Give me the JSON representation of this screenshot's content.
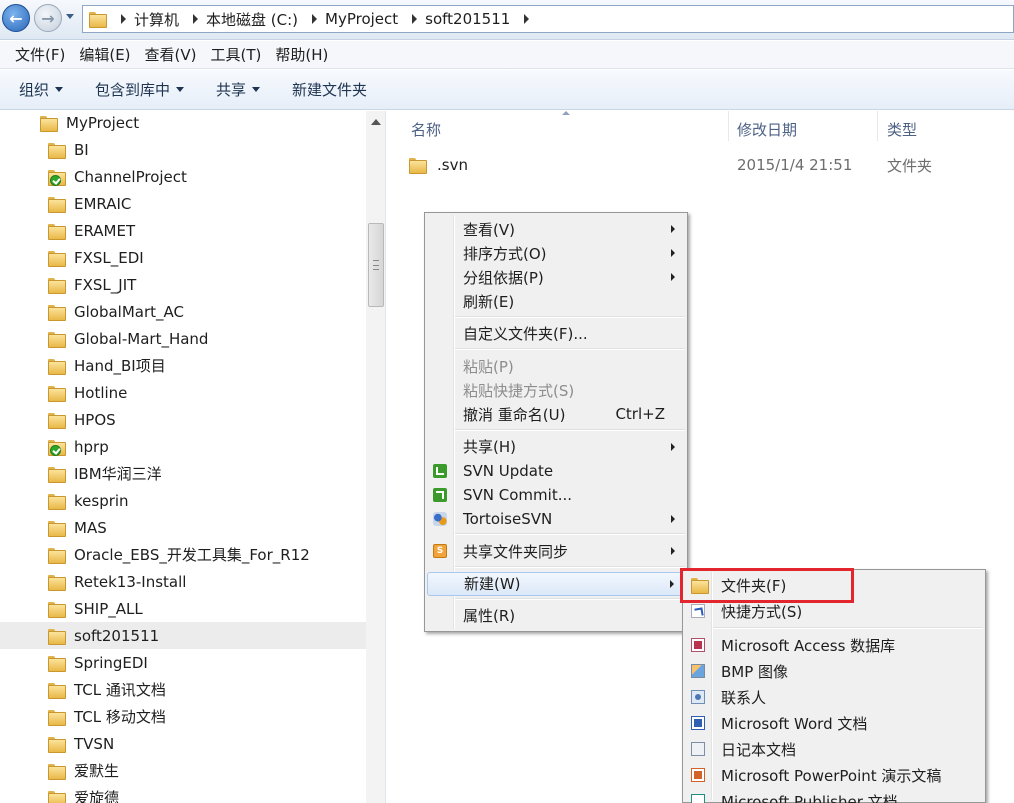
{
  "address": {
    "crumbs": [
      "计算机",
      "本地磁盘 (C:)",
      "MyProject",
      "soft201511"
    ]
  },
  "menubar": [
    "文件(F)",
    "编辑(E)",
    "查看(V)",
    "工具(T)",
    "帮助(H)"
  ],
  "commands": [
    {
      "label": "组织",
      "dropdown": true
    },
    {
      "label": "包含到库中",
      "dropdown": true
    },
    {
      "label": "共享",
      "dropdown": true
    },
    {
      "label": "新建文件夹",
      "dropdown": false
    }
  ],
  "tree": {
    "root": "MyProject",
    "items": [
      {
        "label": "BI",
        "svn": false
      },
      {
        "label": "ChannelProject",
        "svn": true
      },
      {
        "label": "EMRAIC",
        "svn": false
      },
      {
        "label": "ERAMET",
        "svn": false
      },
      {
        "label": "FXSL_EDI",
        "svn": false
      },
      {
        "label": "FXSL_JIT",
        "svn": false
      },
      {
        "label": "GlobalMart_AC",
        "svn": false
      },
      {
        "label": "Global-Mart_Hand",
        "svn": false
      },
      {
        "label": "Hand_BI项目",
        "svn": false
      },
      {
        "label": "Hotline",
        "svn": false
      },
      {
        "label": "HPOS",
        "svn": false
      },
      {
        "label": "hprp",
        "svn": true
      },
      {
        "label": "IBM华润三洋",
        "svn": false
      },
      {
        "label": "kesprin",
        "svn": false
      },
      {
        "label": "MAS",
        "svn": false
      },
      {
        "label": "Oracle_EBS_开发工具集_For_R12",
        "svn": false
      },
      {
        "label": "Retek13-Install",
        "svn": false
      },
      {
        "label": "SHIP_ALL",
        "svn": false
      },
      {
        "label": "soft201511",
        "svn": false,
        "selected": true
      },
      {
        "label": "SpringEDI",
        "svn": false
      },
      {
        "label": "TCL 通讯文档",
        "svn": false
      },
      {
        "label": "TCL 移动文档",
        "svn": false
      },
      {
        "label": "TVSN",
        "svn": false
      },
      {
        "label": "爱默生",
        "svn": false
      },
      {
        "label": "爱旋德",
        "svn": false
      }
    ]
  },
  "filelist": {
    "columns": {
      "name": "名称",
      "modified": "修改日期",
      "type": "类型"
    },
    "rows": [
      {
        "name": ".svn",
        "modified": "2015/1/4 21:51",
        "type": "文件夹"
      }
    ]
  },
  "context_menu": {
    "items": [
      {
        "kind": "item",
        "label": "查看(V)",
        "submenu": true
      },
      {
        "kind": "item",
        "label": "排序方式(O)",
        "submenu": true
      },
      {
        "kind": "item",
        "label": "分组依据(P)",
        "submenu": true
      },
      {
        "kind": "item",
        "label": "刷新(E)"
      },
      {
        "kind": "sep"
      },
      {
        "kind": "item",
        "label": "自定义文件夹(F)..."
      },
      {
        "kind": "sep"
      },
      {
        "kind": "item",
        "label": "粘贴(P)",
        "disabled": true
      },
      {
        "kind": "item",
        "label": "粘贴快捷方式(S)",
        "disabled": true
      },
      {
        "kind": "item",
        "label": "撤消 重命名(U)",
        "shortcut": "Ctrl+Z"
      },
      {
        "kind": "sep"
      },
      {
        "kind": "item",
        "label": "共享(H)",
        "submenu": true
      },
      {
        "kind": "item",
        "label": "SVN Update",
        "icon": "svn-update-icon"
      },
      {
        "kind": "item",
        "label": "SVN Commit...",
        "icon": "svn-commit-icon"
      },
      {
        "kind": "item",
        "label": "TortoiseSVN",
        "icon": "tortoisesvn-icon",
        "submenu": true
      },
      {
        "kind": "sep"
      },
      {
        "kind": "item",
        "label": "共享文件夹同步",
        "icon": "sync-icon",
        "submenu": true
      },
      {
        "kind": "sep"
      },
      {
        "kind": "item",
        "label": "新建(W)",
        "submenu": true,
        "highlighted": true
      },
      {
        "kind": "sep"
      },
      {
        "kind": "item",
        "label": "属性(R)"
      }
    ]
  },
  "new_submenu": {
    "items": [
      {
        "kind": "item",
        "label": "文件夹(F)",
        "icon": "folder-icon"
      },
      {
        "kind": "item",
        "label": "快捷方式(S)",
        "icon": "shortcut-icon"
      },
      {
        "kind": "sep"
      },
      {
        "kind": "item",
        "label": "Microsoft Access 数据库",
        "icon": "access-icon"
      },
      {
        "kind": "item",
        "label": "BMP 图像",
        "icon": "bmp-icon"
      },
      {
        "kind": "item",
        "label": "联系人",
        "icon": "contact-icon"
      },
      {
        "kind": "item",
        "label": "Microsoft Word 文档",
        "icon": "word-icon"
      },
      {
        "kind": "item",
        "label": "日记本文档",
        "icon": "journal-icon"
      },
      {
        "kind": "item",
        "label": "Microsoft PowerPoint 演示文稿",
        "icon": "powerpoint-icon"
      },
      {
        "kind": "item",
        "label": "Microsoft Publisher 文档",
        "icon": "publisher-icon"
      }
    ]
  },
  "colors": {
    "highlight_box": "#e3262d",
    "menu_bg": "#f0f0f0",
    "selection": "#ececec"
  }
}
